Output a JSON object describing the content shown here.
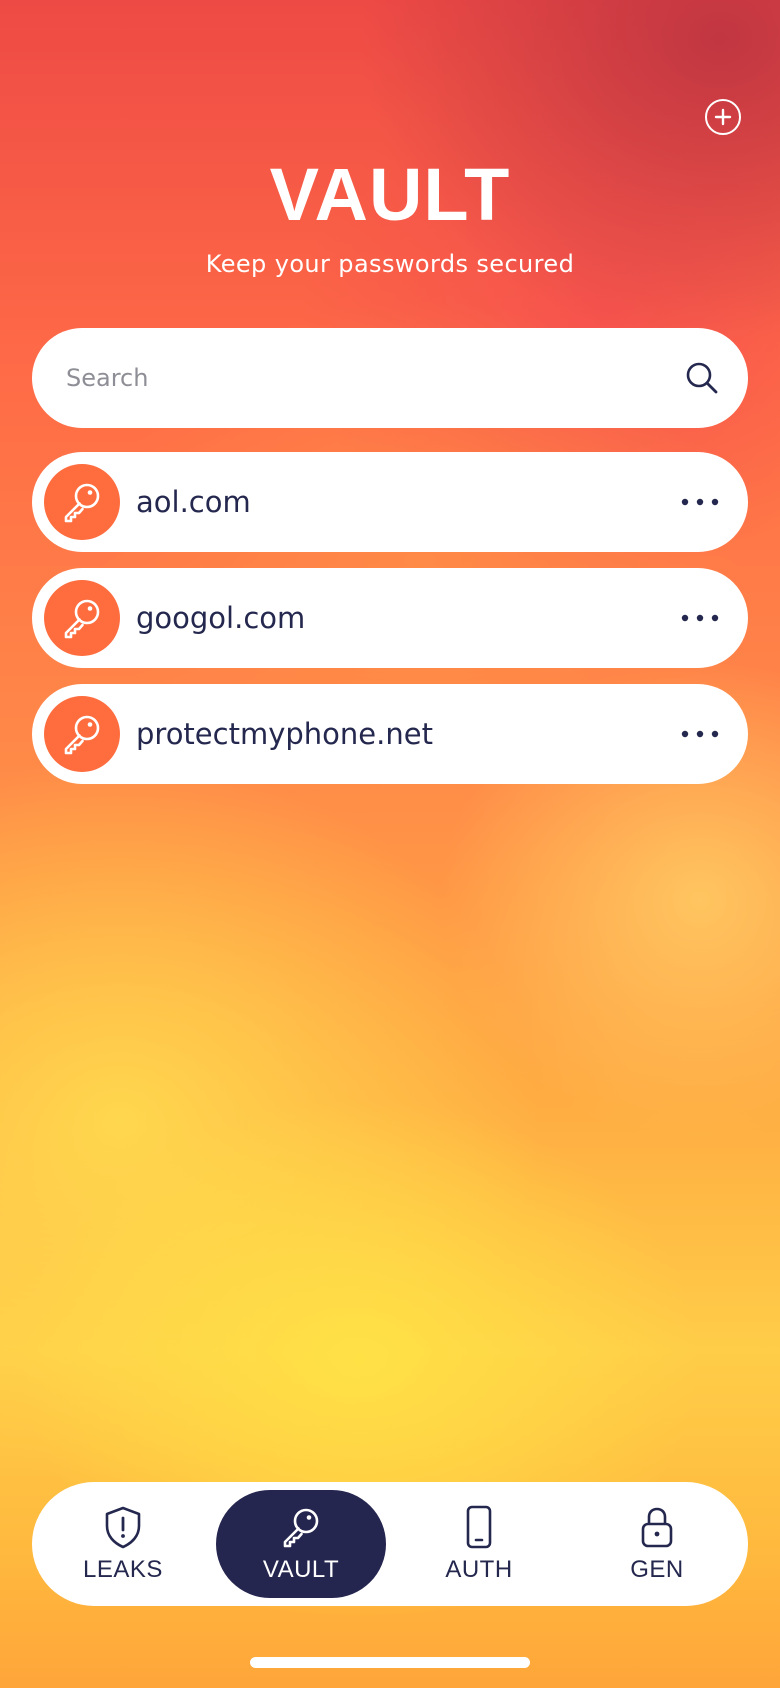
{
  "header": {
    "title": "VAULT",
    "subtitle": "Keep your passwords secured",
    "add_icon": "plus-circle-icon"
  },
  "search": {
    "placeholder": "Search",
    "value": "",
    "icon": "search-icon"
  },
  "vault_items": [
    {
      "name": "aol.com",
      "icon": "key-icon",
      "menu_icon": "more-horizontal-icon"
    },
    {
      "name": "googol.com",
      "icon": "key-icon",
      "menu_icon": "more-horizontal-icon"
    },
    {
      "name": "protectmyphone.net",
      "icon": "key-icon",
      "menu_icon": "more-horizontal-icon"
    }
  ],
  "tabbar": {
    "tabs": [
      {
        "label": "LEAKS",
        "icon": "shield-alert-icon",
        "active": false
      },
      {
        "label": "VAULT",
        "icon": "key-icon",
        "active": true
      },
      {
        "label": "AUTH",
        "icon": "smartphone-icon",
        "active": false
      },
      {
        "label": "GEN",
        "icon": "lock-icon",
        "active": false
      }
    ]
  },
  "colors": {
    "accent": "#ff6d3f",
    "text_dark": "#25284e",
    "active_tab_bg": "#25264f"
  }
}
